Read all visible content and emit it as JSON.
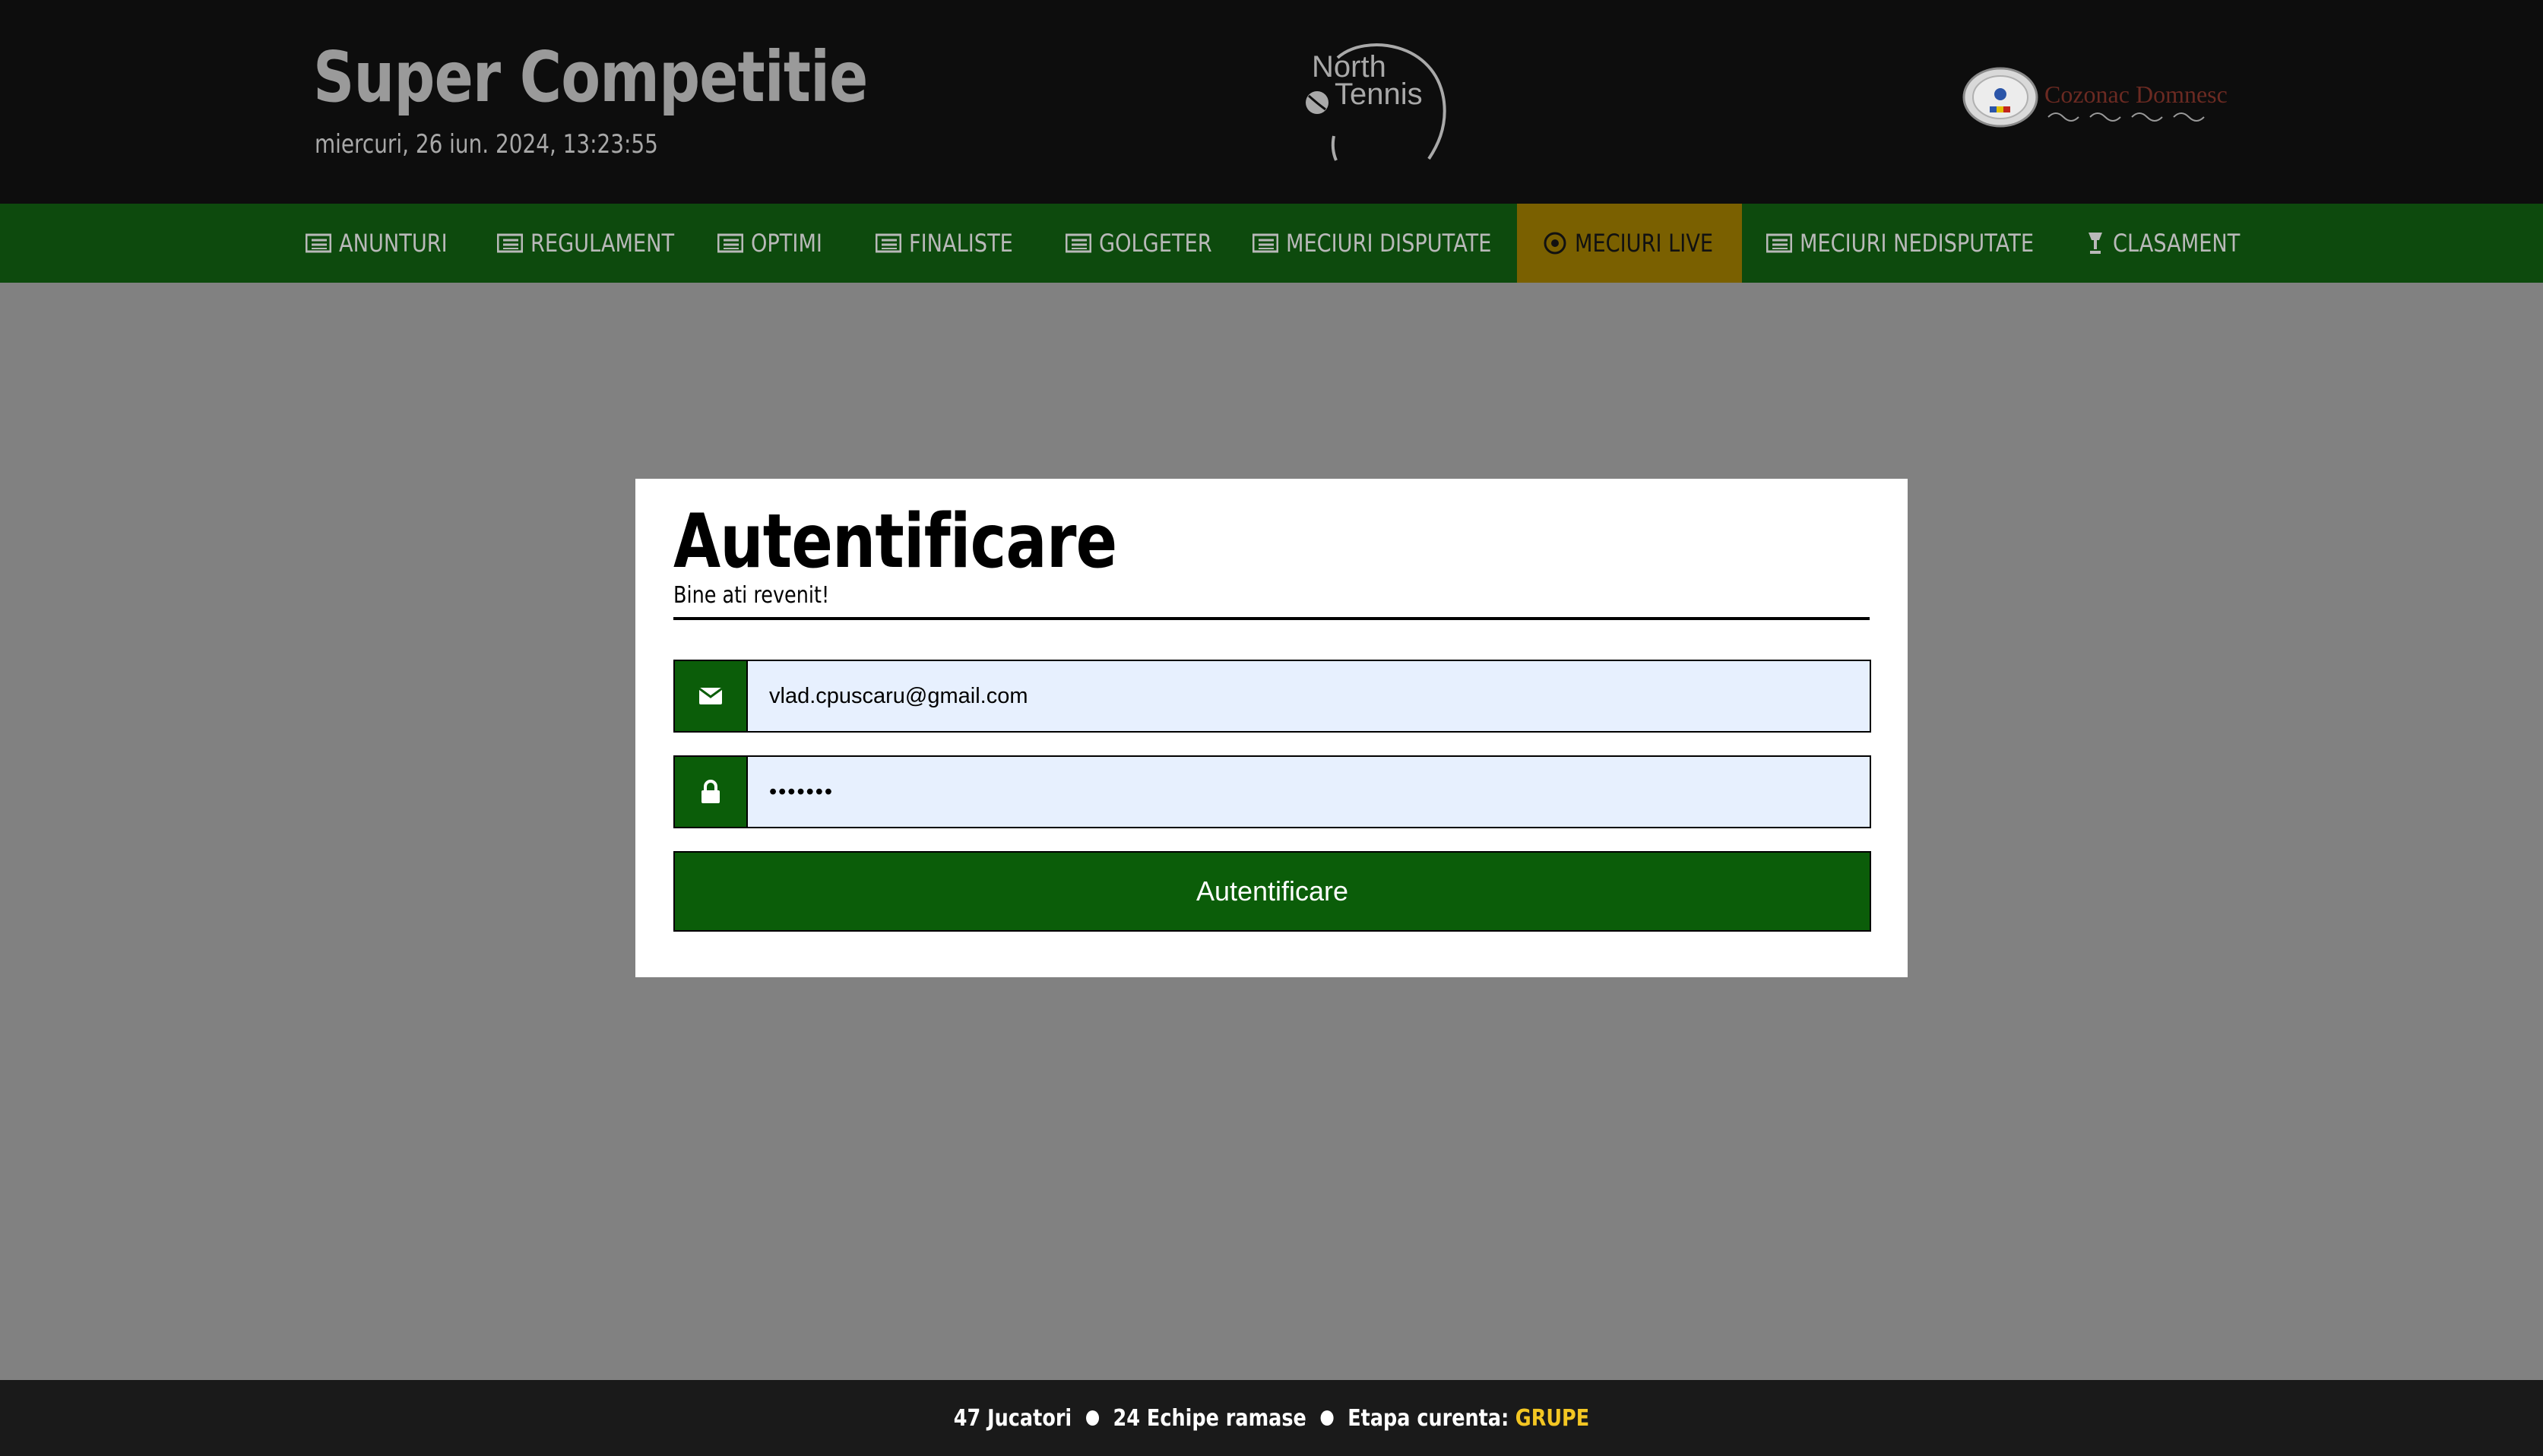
{
  "header": {
    "title": "Super Competitie",
    "date": "miercuri, 26 iun. 2024, 13:23:55",
    "logo_line1": "North",
    "logo_line2": "Tennis",
    "sponsor_text": "Cozonac Domnesc"
  },
  "nav": {
    "items": [
      {
        "label": "ANUNTURI",
        "icon": "list-icon"
      },
      {
        "label": "REGULAMENT",
        "icon": "list-icon"
      },
      {
        "label": "OPTIMI",
        "icon": "list-icon"
      },
      {
        "label": "FINALISTE",
        "icon": "list-icon"
      },
      {
        "label": "GOLGETER",
        "icon": "list-icon"
      },
      {
        "label": "MECIURI DISPUTATE",
        "icon": "list-icon"
      },
      {
        "label": "MECIURI LIVE",
        "icon": "live-circle-icon",
        "active": true
      },
      {
        "label": "MECIURI NEDISPUTATE",
        "icon": "list-icon"
      },
      {
        "label": "CLASAMENT",
        "icon": "trophy-icon"
      }
    ],
    "colors": {
      "bar": "#0d4a0d",
      "active": "#7a6000"
    }
  },
  "login": {
    "title": "Autentificare",
    "subtitle": "Bine ati revenit!",
    "email_value": "vlad.cpuscaru@gmail.com",
    "email_icon": "envelope-icon",
    "password_value": "•••••••",
    "password_icon": "lock-icon",
    "submit_label": "Autentificare",
    "accent": "#0b5d09"
  },
  "footer": {
    "players": "47 Jucatori",
    "teams": "24 Echipe ramase",
    "stage_label": "Etapa curenta:",
    "stage_value": "GRUPE",
    "stage_color": "#f3c623"
  }
}
